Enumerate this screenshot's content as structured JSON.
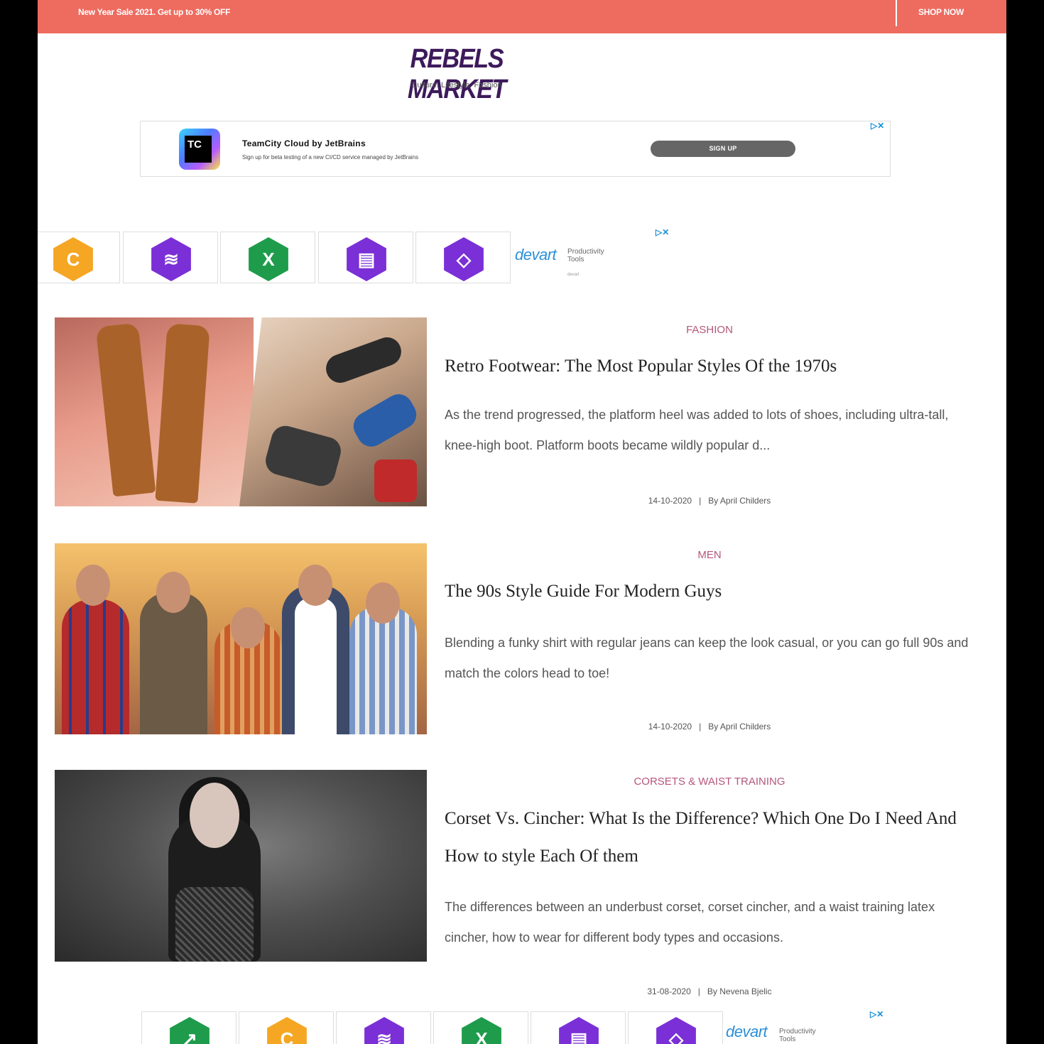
{
  "promo": {
    "text": "New Year Sale 2021. Get up to 30% OFF",
    "cta": "SHOP NOW"
  },
  "header": {
    "logo": "REBELS MARKET",
    "tagline": "Culture. Lifestyle. Fashion"
  },
  "ad_banner": {
    "logo_text": "TC",
    "title": "TeamCity Cloud by JetBrains",
    "subtitle": "Sign up for beta testing of a new CI/CD service managed by JetBrains",
    "button": "SIGN UP",
    "adchoice": "▷✕"
  },
  "ad_strip": {
    "brand": "devart",
    "brand_sub": "Productivity Tools",
    "brand_mini": "devart",
    "adchoice": "▷✕",
    "tiles": [
      {
        "icon": "code-compare-icon",
        "color": "#f5a623",
        "glyph": "C"
      },
      {
        "icon": "layers-icon",
        "color": "#7b2fd6",
        "glyph": "≋"
      },
      {
        "icon": "excel-shopify-icon",
        "color": "#1e9c4b",
        "glyph": "X"
      },
      {
        "icon": "query-builder-icon",
        "color": "#7b2fd6",
        "glyph": "▤"
      },
      {
        "icon": "diagram-icon",
        "color": "#7b2fd6",
        "glyph": "◇"
      }
    ]
  },
  "articles": [
    {
      "category": "FASHION",
      "title": "Retro Footwear: The Most Popular Styles Of the 1970s",
      "excerpt": "As the trend progressed, the platform heel was added to lots of shoes, including ultra-tall, knee-high boot. Platform boots became wildly popular d...",
      "date": "14-10-2020",
      "separator": "|",
      "author": "By April Childers"
    },
    {
      "category": "MEN",
      "title": "The 90s Style Guide For Modern Guys",
      "excerpt": "Blending a funky shirt with regular jeans can keep the look casual, or you can go full 90s and match the colors head to toe!",
      "date": "14-10-2020",
      "separator": "|",
      "author": "By April Childers"
    },
    {
      "category": "CORSETS & WAIST TRAINING",
      "title": "Corset Vs. Cincher: What Is the Difference? Which One Do I Need And How to style Each Of them",
      "excerpt": "The differences between an underbust corset, corset cincher, and a waist training latex cincher, how to wear for different body types and occasions.",
      "date": "31-08-2020",
      "separator": "|",
      "author": "By Nevena Bjelic"
    }
  ],
  "ad_strip_bottom": {
    "brand": "devart",
    "brand_sub": "Productivity Tools",
    "adchoice": "▷✕",
    "tiles": [
      {
        "icon": "arrow-up-icon",
        "color": "#1e9c4b",
        "glyph": "↗"
      },
      {
        "icon": "code-compare-icon",
        "color": "#f5a623",
        "glyph": "C"
      },
      {
        "icon": "layers-icon",
        "color": "#7b2fd6",
        "glyph": "≋"
      },
      {
        "icon": "excel-shopify-icon",
        "color": "#1e9c4b",
        "glyph": "X"
      },
      {
        "icon": "query-builder-icon",
        "color": "#7b2fd6",
        "glyph": "▤"
      },
      {
        "icon": "diagram-icon",
        "color": "#7b2fd6",
        "glyph": "◇"
      }
    ]
  }
}
